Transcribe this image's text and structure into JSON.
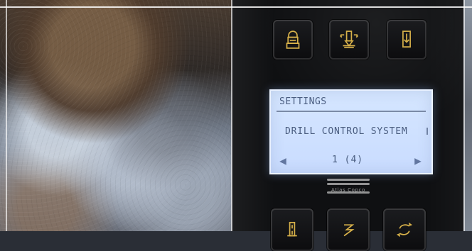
{
  "panel": {
    "top_buttons": [
      {
        "name": "operator-icon",
        "color": "#d7b14a"
      },
      {
        "name": "drill-feed-icon",
        "color": "#d7b14a"
      },
      {
        "name": "drill-down-icon",
        "color": "#d7b14a"
      }
    ],
    "bottom_buttons": [
      {
        "name": "hydraulic-icon",
        "color": "#d7b14a"
      },
      {
        "name": "zigzag-icon",
        "color": "#d7b14a"
      },
      {
        "name": "rotation-icon",
        "color": "#d7b14a"
      }
    ],
    "lcd": {
      "title": "SETTINGS",
      "message": "DRILL CONTROL SYSTEM",
      "page_indicator": "1 (4)",
      "left_arrow": "◀",
      "right_arrow": "▶"
    },
    "logo_text": "Atlas Copco"
  }
}
